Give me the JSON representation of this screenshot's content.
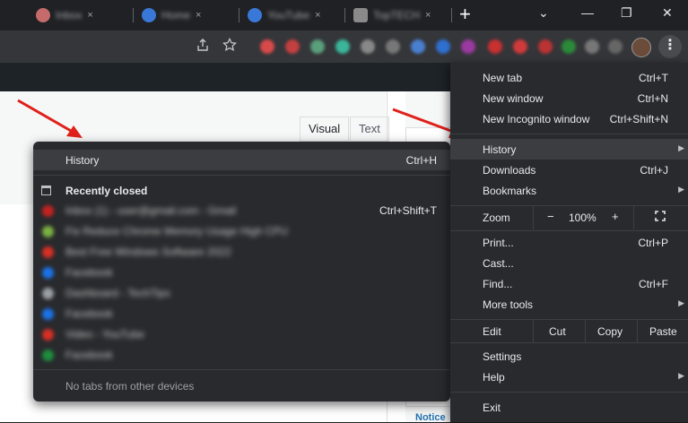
{
  "tabs": [
    {
      "label": "Inbox"
    },
    {
      "label": "Home"
    },
    {
      "label": "YouTube"
    },
    {
      "label": "TopTECH"
    }
  ],
  "window": {
    "new_tab_symbol": "+",
    "minimize": "⌄",
    "restore": "—",
    "maximize": "❐",
    "close": "✕",
    "tab_close": "×"
  },
  "toolbar": {
    "share_icon": "share-icon",
    "star_icon": "star-icon",
    "menu_icon": "⋮"
  },
  "page": {
    "visual_tab": "Visual",
    "text_tab": "Text",
    "side_notice": "Notice"
  },
  "history_submenu": {
    "title": "History",
    "title_shortcut": "Ctrl+H",
    "recently_closed": "Recently closed",
    "items": [
      {
        "text": "Inbox (1) - user@gmail.com - Gmail",
        "shortcut": "Ctrl+Shift+T",
        "color": "#c5221f"
      },
      {
        "text": "Fix Reduce Chrome Memory Usage High CPU",
        "shortcut": "",
        "color": "#7cb342"
      },
      {
        "text": "Best Free Windows Software 2022",
        "shortcut": "",
        "color": "#d93025"
      },
      {
        "text": "Facebook",
        "shortcut": "",
        "color": "#1a73e8"
      },
      {
        "text": "Dashboard - TechTips",
        "shortcut": "",
        "color": "#9aa0a6"
      },
      {
        "text": "Facebook",
        "shortcut": "",
        "color": "#1a73e8"
      },
      {
        "text": "Video - YouTube",
        "shortcut": "",
        "color": "#d93025"
      },
      {
        "text": "Facebook",
        "shortcut": "",
        "color": "#1e8e3e"
      }
    ],
    "footer": "No tabs from other devices"
  },
  "menu": {
    "new_tab": {
      "label": "New tab",
      "shortcut": "Ctrl+T"
    },
    "new_window": {
      "label": "New window",
      "shortcut": "Ctrl+N"
    },
    "new_incognito": {
      "label": "New Incognito window",
      "shortcut": "Ctrl+Shift+N"
    },
    "history": {
      "label": "History"
    },
    "downloads": {
      "label": "Downloads",
      "shortcut": "Ctrl+J"
    },
    "bookmarks": {
      "label": "Bookmarks"
    },
    "zoom": {
      "label": "Zoom",
      "minus": "−",
      "value": "100%",
      "plus": "+"
    },
    "print": {
      "label": "Print...",
      "shortcut": "Ctrl+P"
    },
    "cast": {
      "label": "Cast..."
    },
    "find": {
      "label": "Find...",
      "shortcut": "Ctrl+F"
    },
    "more_tools": {
      "label": "More tools"
    },
    "edit": {
      "label": "Edit",
      "cut": "Cut",
      "copy": "Copy",
      "paste": "Paste"
    },
    "settings": {
      "label": "Settings"
    },
    "help": {
      "label": "Help"
    },
    "exit": {
      "label": "Exit"
    },
    "chevron": "▶"
  },
  "colors": {
    "menu_bg": "#292a2d",
    "highlight": "#3c3d41",
    "arrow": "#e0201a"
  }
}
